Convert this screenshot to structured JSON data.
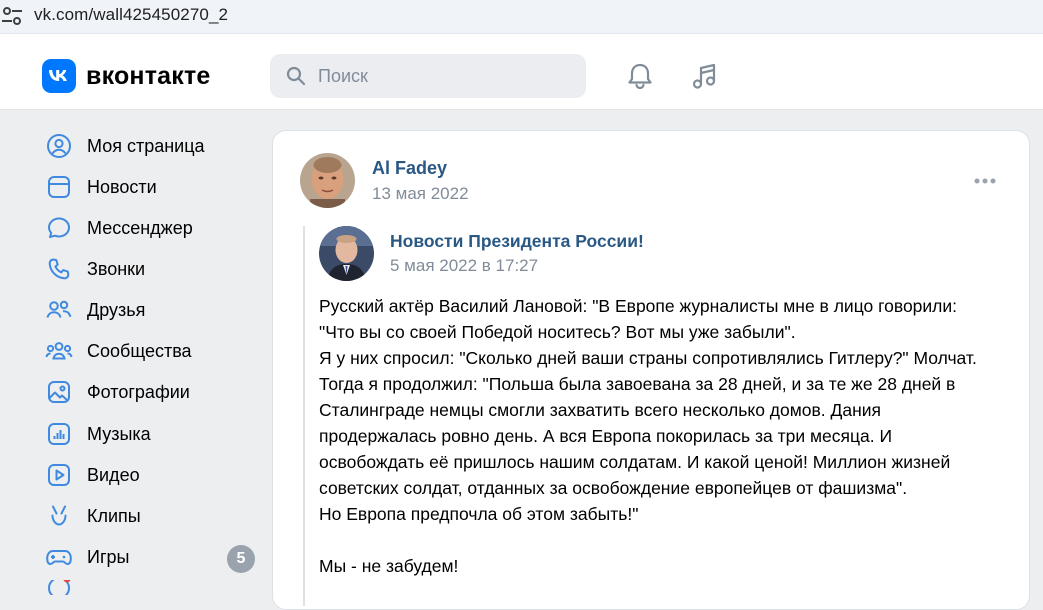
{
  "browser": {
    "url": "vk.com/wall425450270_2"
  },
  "header": {
    "logo_text": "вконтакте",
    "logo_mark": "VK",
    "search_placeholder": "Поиск",
    "accent": "#0077ff"
  },
  "sidebar": {
    "items": [
      {
        "label": "Моя страница",
        "icon": "user-circle-icon"
      },
      {
        "label": "Новости",
        "icon": "news-icon"
      },
      {
        "label": "Мессенджер",
        "icon": "message-icon"
      },
      {
        "label": "Звонки",
        "icon": "phone-icon"
      },
      {
        "label": "Друзья",
        "icon": "friends-icon"
      },
      {
        "label": "Сообщества",
        "icon": "communities-icon"
      },
      {
        "label": "Фотографии",
        "icon": "photo-icon"
      },
      {
        "label": "Музыка",
        "icon": "music-icon"
      },
      {
        "label": "Видео",
        "icon": "video-icon"
      },
      {
        "label": "Клипы",
        "icon": "clips-icon"
      },
      {
        "label": "Игры",
        "icon": "games-icon",
        "badge": "5"
      }
    ]
  },
  "post": {
    "author": "Al Fadey",
    "date": "13 мая 2022",
    "repost": {
      "source": "Новости Президента России!",
      "date": "5 мая 2022 в 17:27",
      "text": "Русский актёр Василий Лановой: \"В Европе журналисты мне в лицо говорили:\n\"Что вы со своей Победой носитесь? Вот мы уже забыли\".\nЯ у них спросил: \"Сколько дней ваши страны сопротивлялись Гитлеру?\" Молчат.\nТогда я продолжил: \"Польша была завоевана за 28 дней, и за те же 28 дней в\nСталинграде немцы смогли захватить всего несколько домов. Дания\nпродержалась ровно день. А вся Европа покорилась за три месяца. И\nосвобождать её пришлось нашим солдатам. И какой ценой! Миллион жизней\nсоветских солдат, отданных за освобождение европейцев от фашизма\".\nНо Европа предпочла об этом забыть!\"\n\nМы - не забудем!"
    }
  }
}
